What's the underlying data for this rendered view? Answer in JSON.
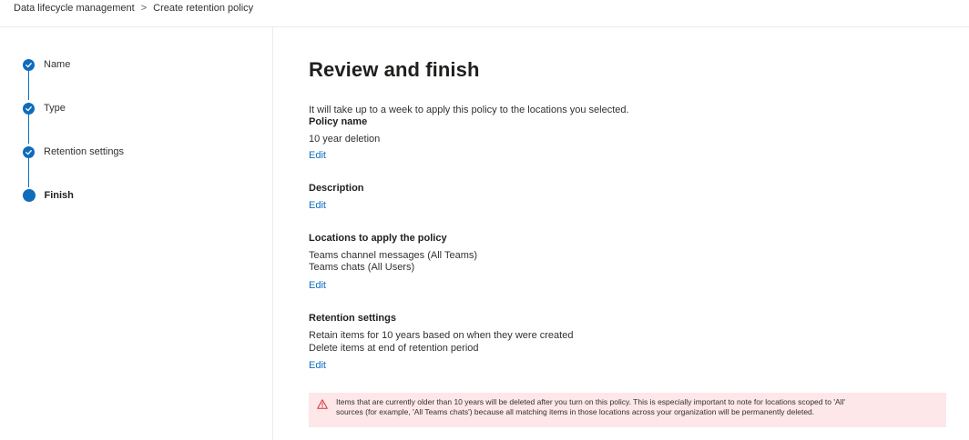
{
  "breadcrumb": {
    "parent": "Data lifecycle management",
    "separator": ">",
    "current": "Create retention policy"
  },
  "steps": [
    {
      "label": "Name",
      "state": "completed"
    },
    {
      "label": "Type",
      "state": "completed"
    },
    {
      "label": "Retention settings",
      "state": "completed"
    },
    {
      "label": "Finish",
      "state": "current"
    }
  ],
  "main": {
    "title": "Review and finish",
    "intro": "It will take up to a week to apply this policy to the locations you selected.",
    "policy_name": {
      "label": "Policy name",
      "value": "10 year deletion",
      "edit": "Edit"
    },
    "description": {
      "label": "Description",
      "edit": "Edit"
    },
    "locations": {
      "label": "Locations to apply the policy",
      "lines": [
        "Teams channel messages (All Teams)",
        "Teams chats (All Users)"
      ],
      "edit": "Edit"
    },
    "retention": {
      "label": "Retention settings",
      "lines": [
        "Retain items for 10 years based on when they were created",
        "Delete items at end of retention period"
      ],
      "edit": "Edit"
    },
    "warning": {
      "icon": "warning-icon",
      "line1": "Items that are currently older than 10 years will be deleted after you turn on this policy. This is especially important to note for locations scoped to 'All'",
      "line2": "sources (for example, 'All Teams chats') because all matching items in those locations across your organization will be permanently deleted."
    }
  },
  "colors": {
    "accent": "#0f6cbd",
    "warning_bg": "#fde7e9",
    "warning_icon": "#d13438"
  }
}
